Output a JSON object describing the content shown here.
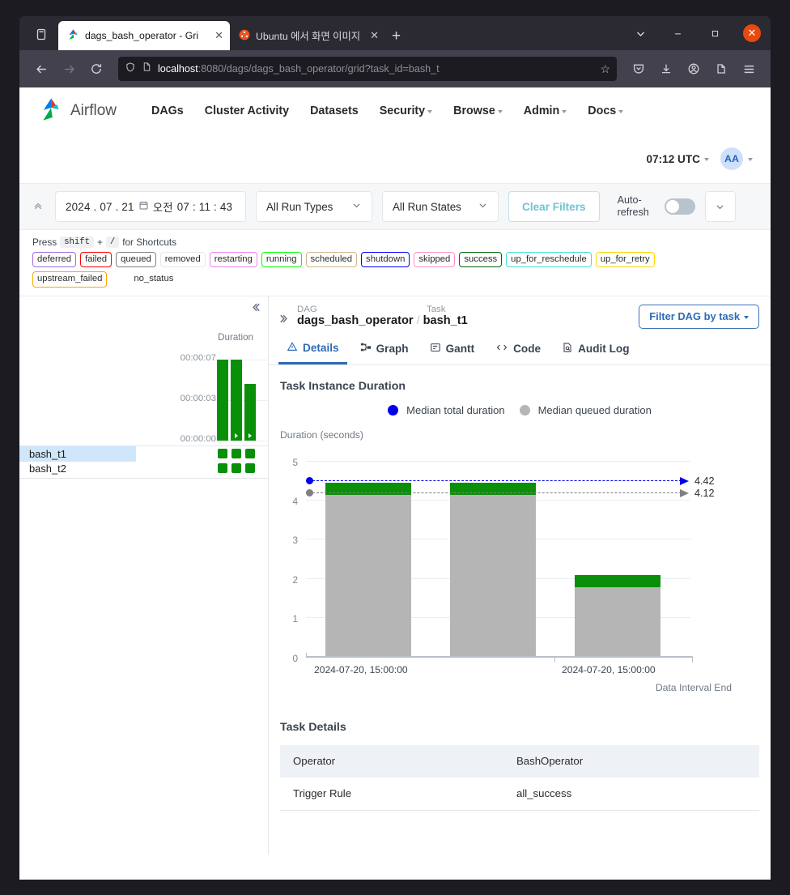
{
  "browser": {
    "tabs": [
      {
        "title": "dags_bash_operator - Gri",
        "favicon": "airflow-icon",
        "active": true,
        "close_label": "✕"
      },
      {
        "title": "Ubuntu 에서 화면 이미지 캡",
        "favicon": "ubuntu-icon",
        "active": false,
        "close_label": "✕"
      }
    ],
    "new_tab_label": "+",
    "tab_list_icon": "tab-list-icon",
    "window_controls": {
      "list_all_tabs": "⌄",
      "minimize": "–",
      "maximize": "☐",
      "close": "✕"
    },
    "toolbar": {
      "back": "←",
      "forward": "→",
      "reload": "↻",
      "shield_icon": "shield-icon",
      "page_icon": "page-icon",
      "url_host": "localhost",
      "url_path": ":8080/dags/dags_bash_operator/grid?task_id=bash_t",
      "bookmark": "☆",
      "pocket": "▽",
      "downloads": "⤓",
      "account": "◉",
      "extensions": "⎘",
      "menu": "☰"
    }
  },
  "airflow": {
    "brand": "Airflow",
    "nav_items": [
      {
        "label": "DAGs",
        "has_caret": false
      },
      {
        "label": "Cluster Activity",
        "has_caret": false
      },
      {
        "label": "Datasets",
        "has_caret": false
      },
      {
        "label": "Security",
        "has_caret": true
      },
      {
        "label": "Browse",
        "has_caret": true
      },
      {
        "label": "Admin",
        "has_caret": true
      },
      {
        "label": "Docs",
        "has_caret": true
      }
    ],
    "clock": "07:12 UTC",
    "user_initials": "AA"
  },
  "filters": {
    "collapse_icon": "chevron-double-up-icon",
    "date_value": "2024 . 07 . 21",
    "date_calendar_icon": "calendar-icon",
    "time_meridiem": "오전",
    "time_value": "07 : 11 : 43",
    "run_types": "All Run Types",
    "run_states": "All Run States",
    "clear_filters": "Clear Filters",
    "auto_refresh_label": "Auto-refresh",
    "auto_refresh_on": false,
    "more_chevron": "⌄"
  },
  "shortcuts": {
    "prefix": "Press",
    "key1": "shift",
    "plus": "+",
    "key2": "/",
    "suffix": "for Shortcuts",
    "states": [
      {
        "label": "deferred",
        "color": "#9c6ade"
      },
      {
        "label": "failed",
        "color": "#ff0000"
      },
      {
        "label": "queued",
        "color": "#808080"
      },
      {
        "label": "removed",
        "color": "#e8e8e8"
      },
      {
        "label": "restarting",
        "color": "#ee82ee"
      },
      {
        "label": "running",
        "color": "#00ff00"
      },
      {
        "label": "scheduled",
        "color": "#d2b48c"
      },
      {
        "label": "shutdown",
        "color": "#0000ff"
      },
      {
        "label": "skipped",
        "color": "#ff8fd1"
      },
      {
        "label": "success",
        "color": "#00650a"
      },
      {
        "label": "up_for_reschedule",
        "color": "#40e0d0"
      },
      {
        "label": "up_for_retry",
        "color": "#ffd700"
      },
      {
        "label": "upstream_failed",
        "color": "#ffa500"
      },
      {
        "label": "no_status",
        "color": "#ffffff"
      }
    ]
  },
  "grid": {
    "collapse_icon": "chevron-double-left-icon",
    "duration_label": "Duration",
    "y_ticks": [
      "00:00:07",
      "00:00:03",
      "00:00:00"
    ],
    "bars": [
      {
        "height_pct": 100,
        "has_marker": false
      },
      {
        "height_pct": 100,
        "has_marker": true
      },
      {
        "height_pct": 70,
        "has_marker": true
      }
    ],
    "tasks": [
      {
        "label": "bash_t1",
        "selected": true,
        "states": [
          "success",
          "success",
          "success"
        ]
      },
      {
        "label": "bash_t2",
        "selected": false,
        "states": [
          "success",
          "success",
          "success"
        ]
      }
    ]
  },
  "detail": {
    "expand_icon": "chevron-double-right-icon",
    "dag_caption": "DAG",
    "dag_name": "dags_bash_operator",
    "separator": "/",
    "task_caption": "Task",
    "task_name": "bash_t1",
    "filter_dag_button": "Filter DAG by task",
    "tabs": [
      {
        "label": "Details",
        "icon": "warning-triangle-icon",
        "active": true
      },
      {
        "label": "Graph",
        "icon": "graph-nodes-icon",
        "active": false
      },
      {
        "label": "Gantt",
        "icon": "gantt-icon",
        "active": false
      },
      {
        "label": "Code",
        "icon": "code-brackets-icon",
        "active": false
      },
      {
        "label": "Audit Log",
        "icon": "document-search-icon",
        "active": false
      }
    ],
    "chart_section_title": "Task Instance Duration",
    "task_details_title": "Task Details",
    "task_details_rows": [
      {
        "key": "Operator",
        "value": "BashOperator"
      },
      {
        "key": "Trigger Rule",
        "value": "all_success"
      }
    ]
  },
  "chart_data": {
    "type": "bar",
    "title": "Task Instance Duration",
    "xlabel": "Data Interval End",
    "ylabel": "Duration (seconds)",
    "ylim": [
      0,
      5
    ],
    "yticks": [
      0,
      1,
      2,
      3,
      4,
      5
    ],
    "grid": true,
    "legend_position": "top-center",
    "stacked": true,
    "x": [
      "2024-07-20, 15:00:00",
      "",
      "2024-07-20, 15:00:00"
    ],
    "xtick_labels": [
      "2024-07-20, 15:00:00",
      "2024-07-20, 15:00:00"
    ],
    "series": [
      {
        "name": "Median queued duration",
        "color": "#b5b5b5",
        "values": [
          4.12,
          4.12,
          1.78
        ]
      },
      {
        "name": "Median total duration",
        "color": "#0a8f08",
        "values": [
          4.42,
          4.42,
          2.08
        ]
      }
    ],
    "reference_lines": [
      {
        "label": "4.42",
        "value": 4.42,
        "color": "#0000ee",
        "style": "dashed",
        "series": "Median total duration"
      },
      {
        "label": "4.12",
        "value": 4.12,
        "color": "#808080",
        "style": "dashed",
        "series": "Median queued duration"
      }
    ]
  }
}
